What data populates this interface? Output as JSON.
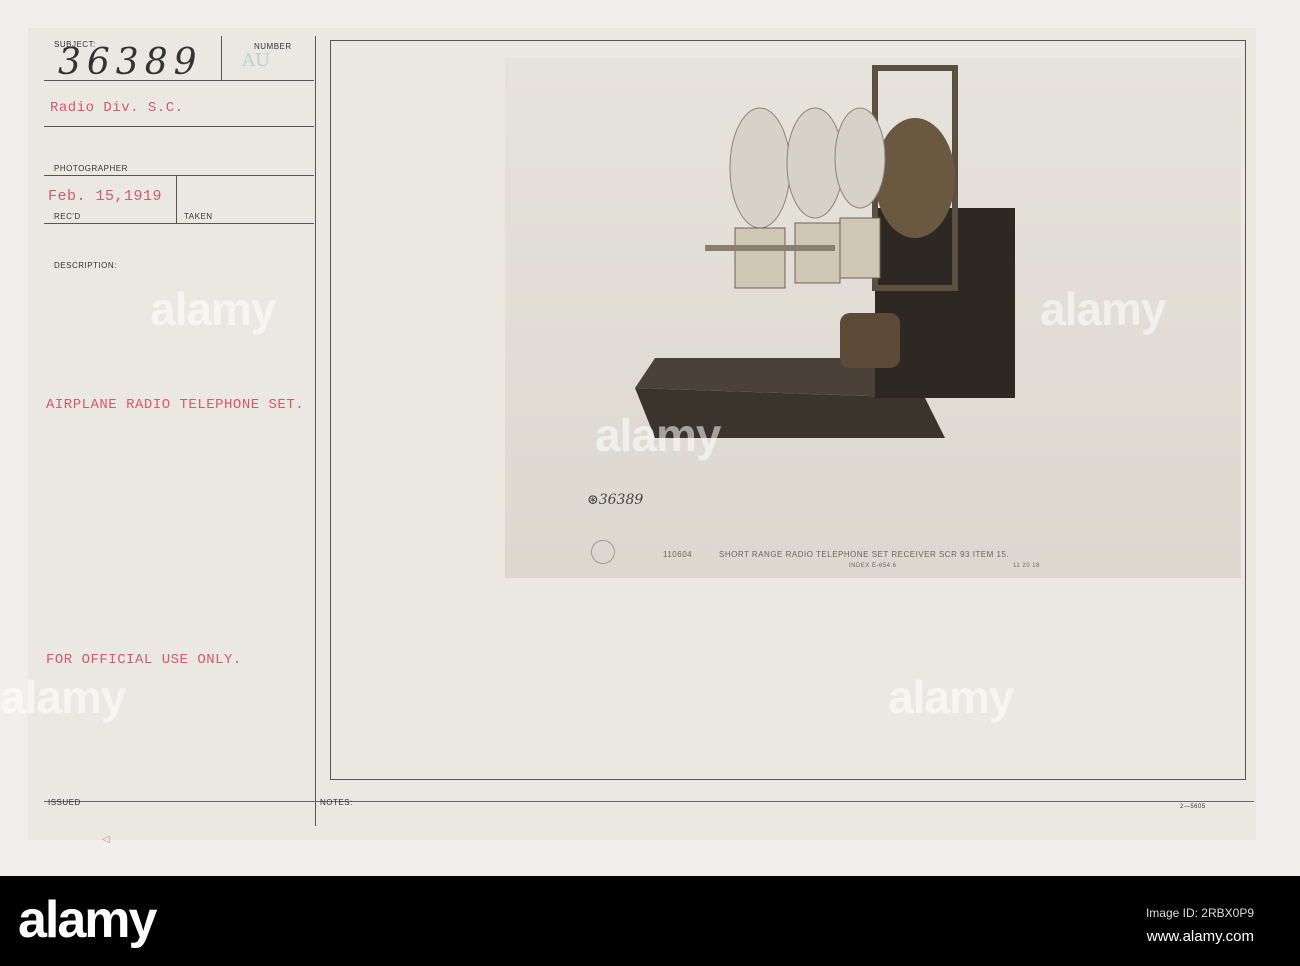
{
  "card": {
    "subject_label": "SUBJECT:",
    "subject_number": "36389",
    "number_label": "NUMBER",
    "number_value": "AU",
    "unit": "Radio Div. S.C.",
    "photographer_label": "PHOTOGRAPHER",
    "received_date": "Feb. 15,1919",
    "recd_label": "REC'D",
    "taken_label": "TAKEN",
    "description_label": "DESCRIPTION:",
    "description": "AIRPLANE RADIO TELEPHONE SET.",
    "restriction": "FOR OFFICIAL USE ONLY.",
    "issued_label": "ISSUED",
    "notes_label": "NOTES:",
    "form_number": "2—5605"
  },
  "photo": {
    "handwritten_number": "⊛36389",
    "catalog_number": "110604",
    "caption": "SHORT RANGE RADIO TELEPHONE SET RECEIVER SCR 93 ITEM 15.",
    "index": "INDEX E-654.6",
    "date": "11 20 18"
  },
  "watermark": "alamy",
  "footer": {
    "logo": "alamy",
    "image_id": "Image ID: 2RBX0P9",
    "url": "www.alamy.com"
  }
}
